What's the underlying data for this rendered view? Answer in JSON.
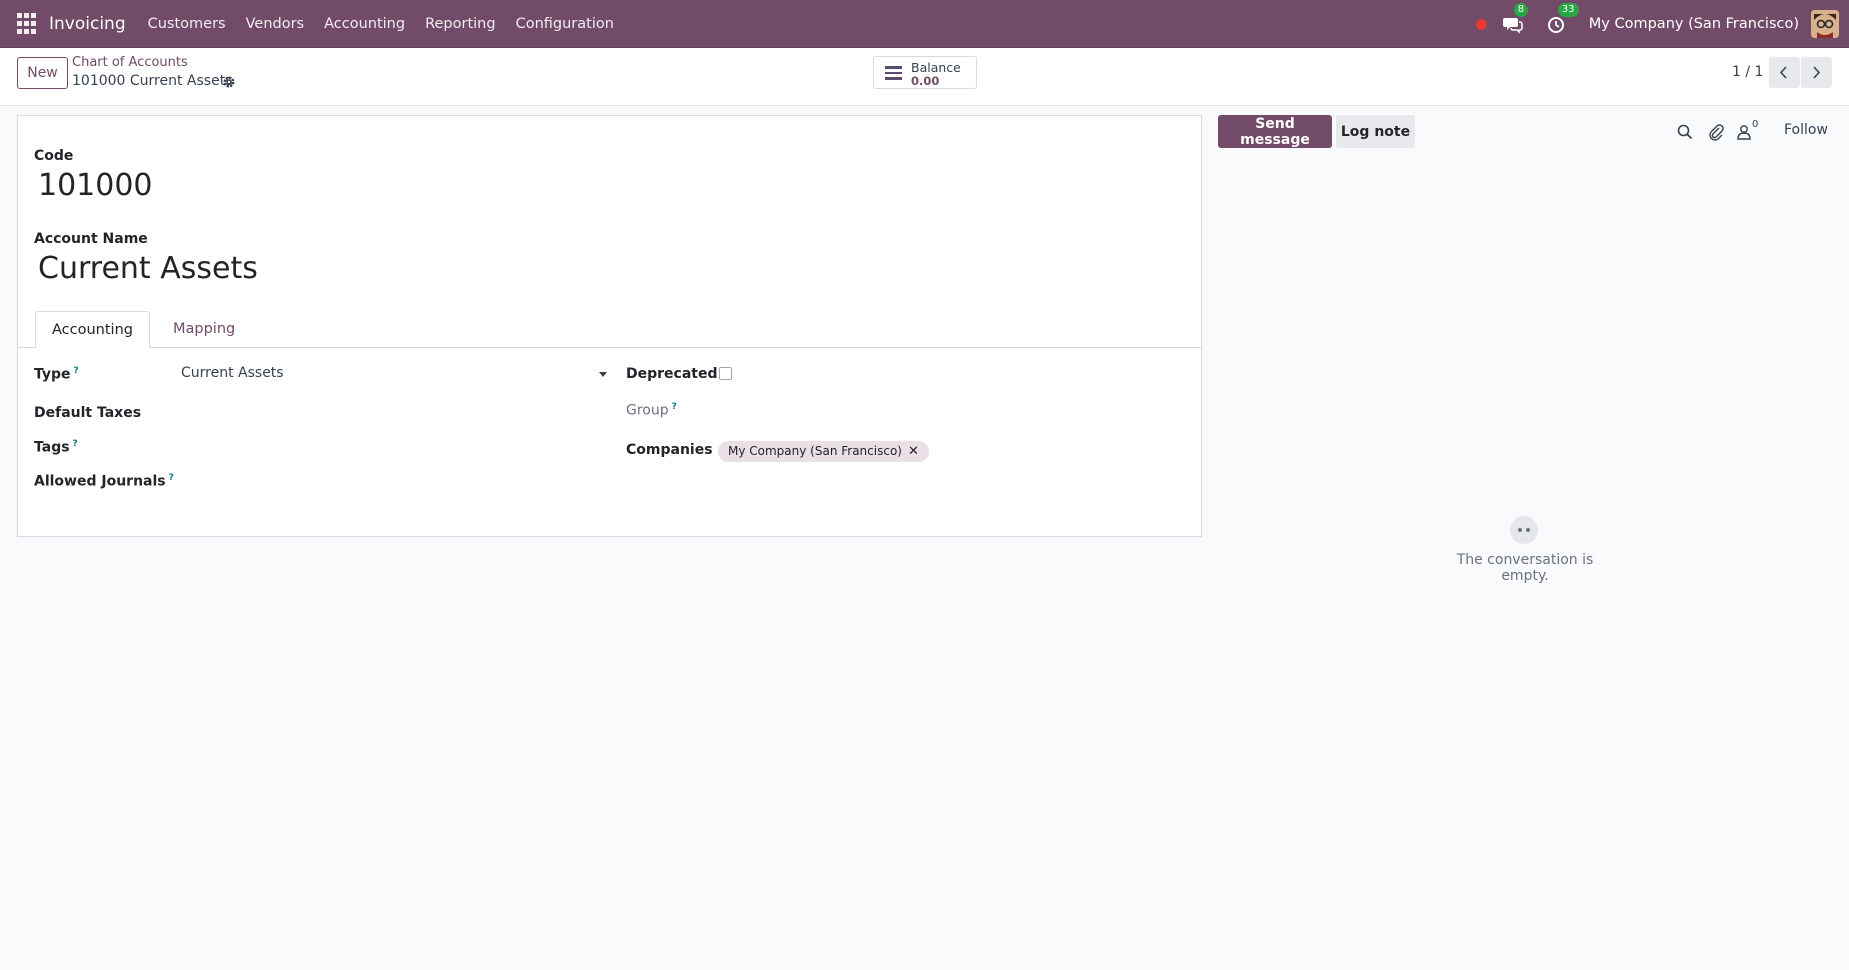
{
  "navbar": {
    "app_name": "Invoicing",
    "menu": [
      "Customers",
      "Vendors",
      "Accounting",
      "Reporting",
      "Configuration"
    ],
    "messages_badge": "8",
    "activities_badge": "33",
    "company": "My Company (San Francisco)",
    "color": "#714b67"
  },
  "control_panel": {
    "new_label": "New",
    "breadcrumb_parent": "Chart of Accounts",
    "breadcrumb_current": "101000 Current Assets",
    "balance_label": "Balance",
    "balance_value": "0.00",
    "pager": "1 / 1"
  },
  "form": {
    "code_label": "Code",
    "code_value": "101000",
    "name_label": "Account Name",
    "name_value": "Current Assets",
    "tabs": [
      "Accounting",
      "Mapping"
    ],
    "type_label": "Type",
    "type_value": "Current Assets",
    "default_taxes_label": "Default Taxes",
    "tags_label": "Tags",
    "allowed_journals_label": "Allowed Journals",
    "deprecated_label": "Deprecated",
    "deprecated_checked": false,
    "group_label": "Group",
    "companies_label": "Companies",
    "companies_value": "My Company (San Francisco)",
    "help_mark": "?"
  },
  "chatter": {
    "send_message": "Send message",
    "log_note": "Log note",
    "followers_count": "0",
    "follow": "Follow",
    "empty_text": "The conversation is empty."
  }
}
